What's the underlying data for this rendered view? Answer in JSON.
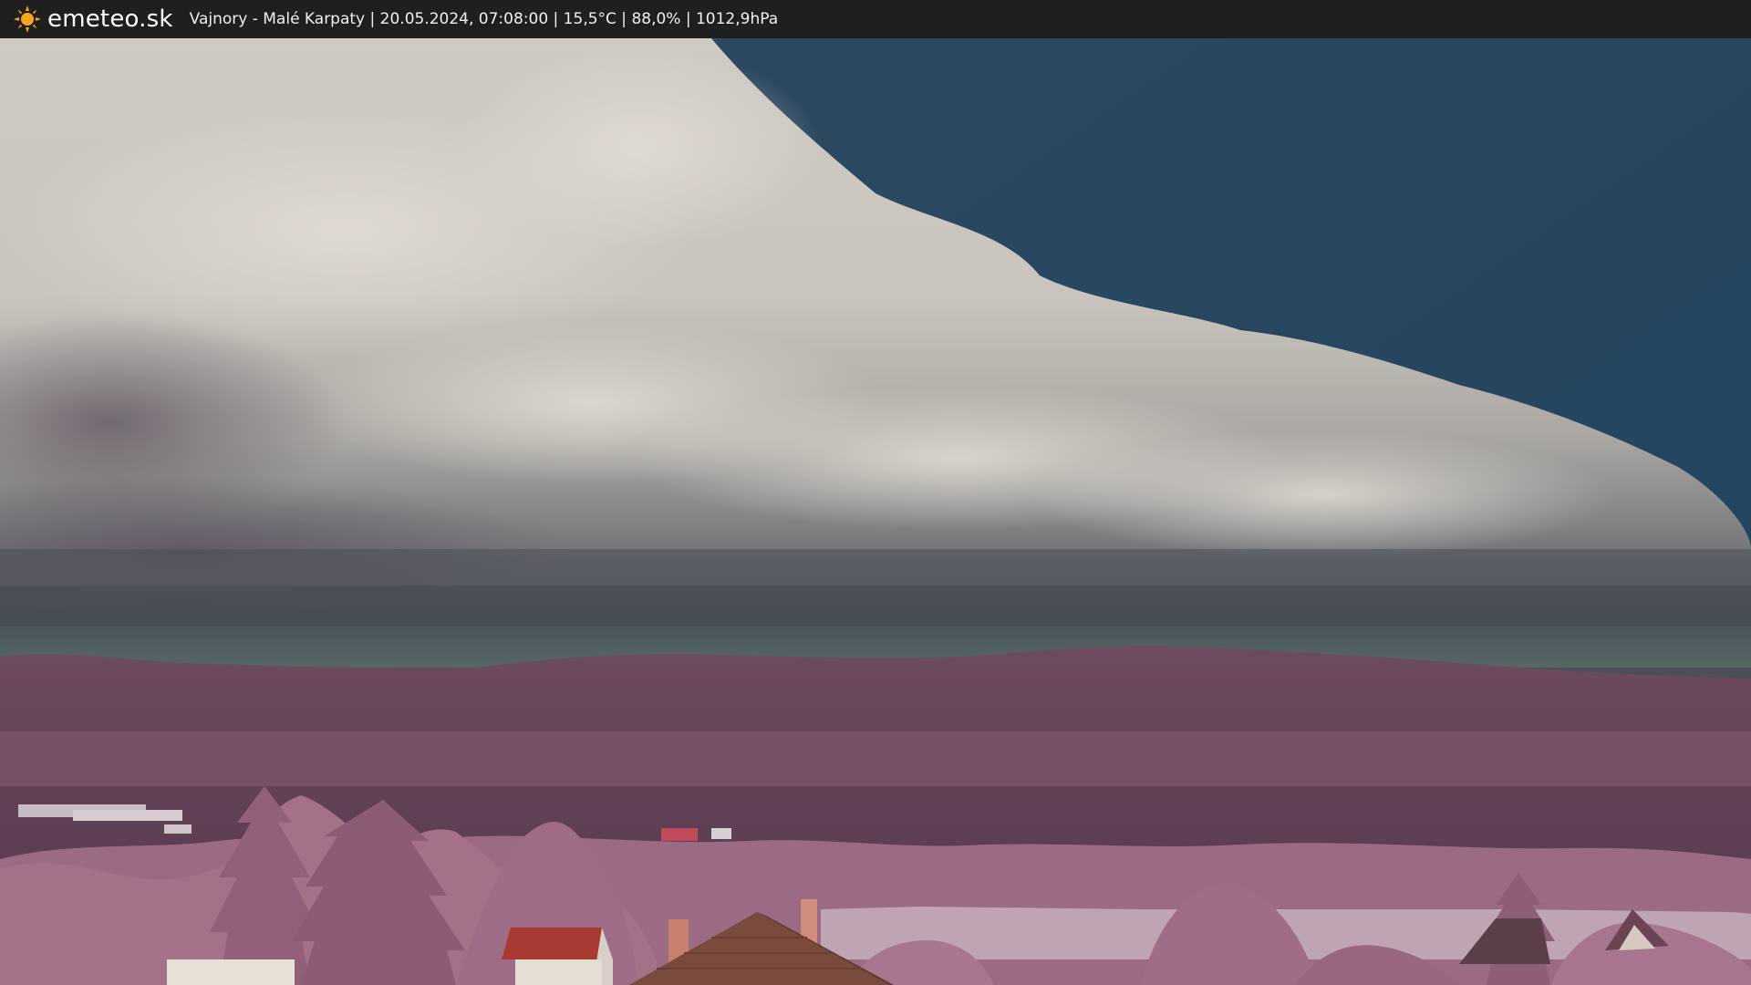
{
  "header": {
    "brand": "emeteo.sk",
    "logo_icon": "sun-icon",
    "caption": "Vajnory - Malé Karpaty | 20.05.2024, 07:08:00 | 15,5°C | 88,0% | 1012,9hPa"
  },
  "colors": {
    "bar_background": "#1f1f1f",
    "logo_sun": "#f5a623",
    "sky_blue": "#2c4d66",
    "cloud_light": "#d6d1c9",
    "cloud_dark": "#545760",
    "hills": "#6b4a5f",
    "foliage": "#a5728c",
    "roof_red": "#a83a32",
    "roof_brown": "#7a4a3c"
  }
}
